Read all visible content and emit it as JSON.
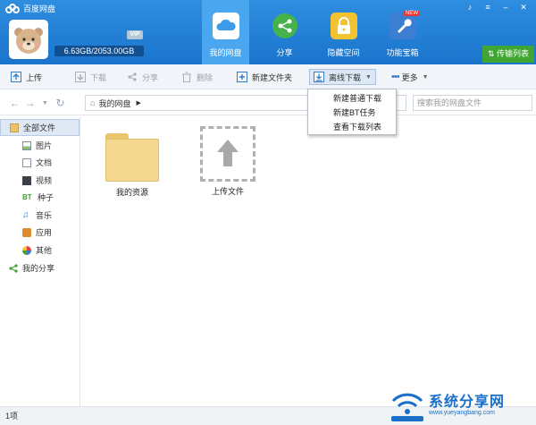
{
  "app": {
    "title": "百度网盘"
  },
  "account": {
    "quota": "6.63GB/2053.00GB",
    "vip_badge": "VIP"
  },
  "nav_tabs": [
    {
      "label": "我的网盘",
      "active": true
    },
    {
      "label": "分享"
    },
    {
      "label": "隐藏空间"
    },
    {
      "label": "功能宝箱",
      "badge": "NEW"
    }
  ],
  "transfer_list": "传输列表",
  "toolbar": {
    "upload": "上传",
    "download": "下载",
    "share": "分享",
    "delete": "删除",
    "new_folder": "新建文件夹",
    "offline_download": "离线下载",
    "more": "更多"
  },
  "dropdown": {
    "items": [
      "新建普通下载",
      "新建BT任务",
      "查看下载列表"
    ]
  },
  "breadcrumb": {
    "root": "我的网盘"
  },
  "search": {
    "placeholder": "搜索我的网盘文件"
  },
  "sidebar": {
    "all_files": "全部文件",
    "items": [
      {
        "label": "图片"
      },
      {
        "label": "文档"
      },
      {
        "label": "视频"
      },
      {
        "label": "种子"
      },
      {
        "label": "音乐"
      },
      {
        "label": "应用"
      },
      {
        "label": "其他"
      }
    ],
    "my_share": "我的分享"
  },
  "files": [
    {
      "name": "我的资源",
      "type": "folder"
    },
    {
      "name": "上传文件",
      "type": "upload"
    }
  ],
  "status": {
    "count": "1项"
  },
  "watermark": {
    "text": "系统分享网",
    "url": "www.yueyangbang.com"
  },
  "colors": {
    "header": "#1a74cc",
    "active_tab": "#4aa6ef",
    "transfer_green": "#3fa634",
    "folder": "#f5d98f"
  }
}
